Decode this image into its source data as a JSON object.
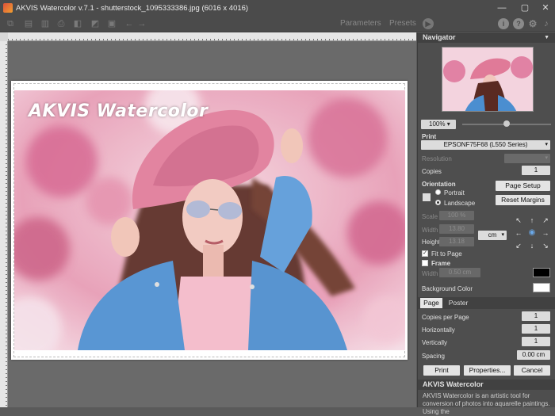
{
  "window": {
    "title": "AKVIS Watercolor v.7.1 - shutterstock_1095333386.jpg (6016 x 4016)",
    "minimize": "—",
    "maximize": "▢",
    "close": "✕"
  },
  "toolbar": {
    "parameters": "Parameters",
    "presets": "Presets"
  },
  "canvas": {
    "watermark": "AKVIS Watercolor"
  },
  "navigator": {
    "title": "Navigator",
    "zoom": "100%"
  },
  "print": {
    "title": "Print",
    "printer": "EPSONF75F68 (L550 Series)",
    "resolution_label": "Resolution",
    "copies_label": "Copies",
    "copies": "1",
    "orientation_label": "Orientation",
    "portrait": "Portrait",
    "landscape": "Landscape",
    "page_setup": "Page Setup",
    "reset_margins": "Reset Margins",
    "scale_label": "Scale",
    "scale": "100 %",
    "width_label": "Width",
    "width": "13.80",
    "height_label": "Height",
    "height": "13.18",
    "unit": "cm",
    "fit_to_page": "Fit to Page",
    "frame": "Frame",
    "frame_width_label": "Width",
    "frame_width": "0.50 cm",
    "background_color_label": "Background Color",
    "background_color": "#ffffff",
    "frame_color": "#000000"
  },
  "tabs": {
    "page": "Page",
    "poster": "Poster"
  },
  "page": {
    "copies_per_page_label": "Copies per Page",
    "copies_per_page": "1",
    "horizontally_label": "Horizontally",
    "horizontally": "1",
    "vertically_label": "Vertically",
    "vertically": "1",
    "spacing_label": "Spacing",
    "spacing": "0.00 cm"
  },
  "buttons": {
    "print": "Print",
    "properties": "Properties...",
    "cancel": "Cancel"
  },
  "about": {
    "title": "AKVIS Watercolor",
    "text": "AKVIS Watercolor is an artistic tool for conversion of photos into aquarelle paintings. Using the"
  }
}
